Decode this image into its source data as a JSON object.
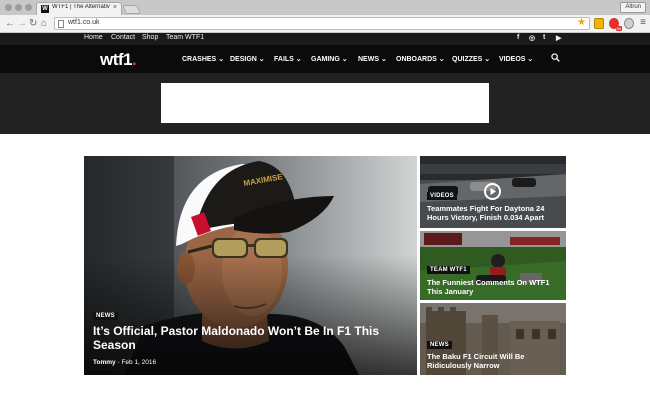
{
  "browser": {
    "tab_title": "WTF1 | The Alternative F1 ...",
    "tab_favicon": "W",
    "profile_label": "Altrun",
    "url": "wtf1.co.uk",
    "extension_badge": "89"
  },
  "topnav": {
    "links": [
      "Home",
      "Contact",
      "Shop",
      "Team WTF1"
    ],
    "social": [
      "f",
      "◎",
      "t",
      "▶"
    ]
  },
  "header": {
    "logo_text": "wtf1",
    "logo_dot": ".",
    "menu": [
      "CRASHES",
      "DESIGN",
      "FAILS",
      "GAMING",
      "NEWS",
      "ONBOARDS",
      "QUIZZES",
      "VIDEOS"
    ]
  },
  "featured": {
    "main": {
      "category": "NEWS",
      "title": "It’s Official, Pastor Maldonado Won’t Be In F1 This Season",
      "author": "Tommy",
      "separator": "-",
      "date": "Feb 1, 2016"
    },
    "side": [
      {
        "category": "VIDEOS",
        "title": "Teammates Fight For Daytona 24 Hours Victory, Finish 0.034 Apart"
      },
      {
        "category": "TEAM WTF1",
        "title": "The Funniest Comments On WTF1 This January"
      },
      {
        "category": "NEWS",
        "title": "The Baku F1 Circuit Will Be Ridiculously Narrow"
      }
    ]
  },
  "colors": {
    "topbar": "#1a1a1a",
    "header": "#0b0b0b",
    "ad_band": "#222222",
    "logo_dot": "#e53935"
  },
  "icons": [
    "back-icon",
    "forward-icon",
    "reload-icon",
    "home-icon",
    "star-icon",
    "search-icon",
    "play-icon",
    "chevron-down-icon",
    "menu-icon"
  ]
}
